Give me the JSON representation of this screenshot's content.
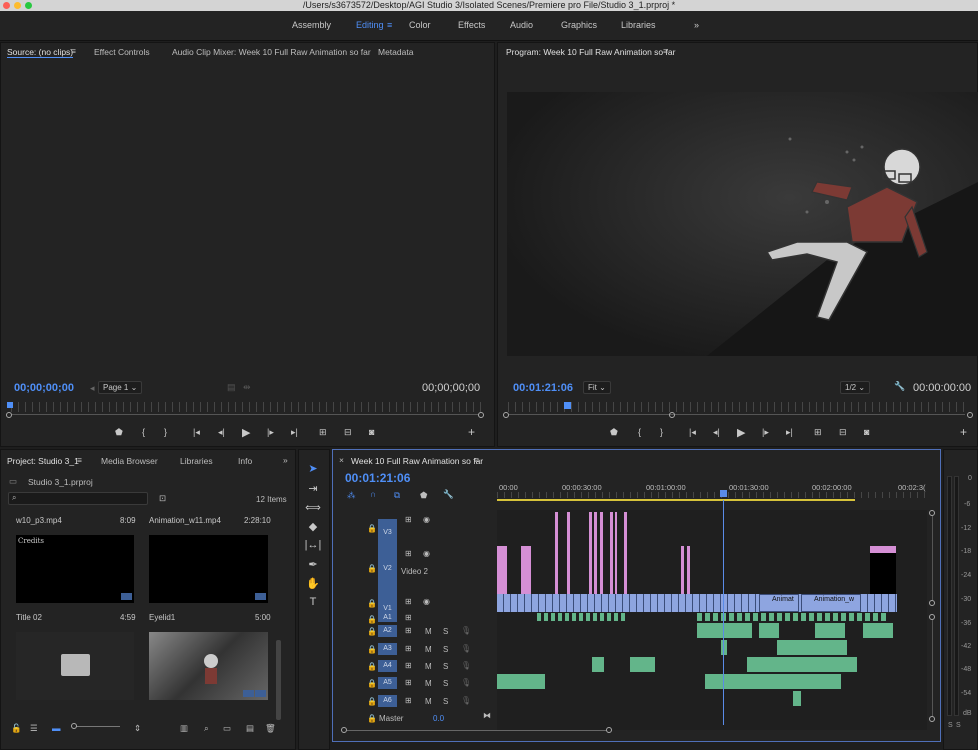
{
  "window": {
    "title": "/Users/s3673572/Desktop/AGI Studio 3/Isolated Scenes/Premiere pro File/Studio 3_1.prproj *"
  },
  "workspaces": {
    "items": [
      "Assembly",
      "Editing",
      "Color",
      "Effects",
      "Audio",
      "Graphics",
      "Libraries"
    ],
    "active": "Editing",
    "more": "»"
  },
  "source": {
    "tabs": [
      "Source: (no clips)",
      "Effect Controls",
      "Audio Clip Mixer: Week 10 Full Raw Animation so far",
      "Metadata"
    ],
    "timecode_in": "00;00;00;00",
    "timecode_out": "00;00;00;00",
    "page": "Page 1"
  },
  "program": {
    "title": "Program: Week 10 Full Raw Animation so far",
    "timecode": "00:01:21:06",
    "zoom": "Fit",
    "resolution": "1/2",
    "duration": "00:00:00:00"
  },
  "project": {
    "tabs": [
      "Project: Studio 3_1",
      "Media Browser",
      "Libraries",
      "Info"
    ],
    "more": "»",
    "file": "Studio 3_1.prproj",
    "count": "12 Items",
    "items": [
      {
        "name": "w10_p3.mp4",
        "dur": "8:09"
      },
      {
        "name": "Animation_w11.mp4",
        "dur": "2:28:10"
      },
      {
        "name": "Title 02",
        "dur": "4:59"
      },
      {
        "name": "Eyelid1",
        "dur": "5:00"
      }
    ],
    "thumb_text": "Credits"
  },
  "timeline": {
    "title": "Week 10 Full Raw Animation so far",
    "timecode": "00:01:21:06",
    "ruler": [
      "00:00",
      "00:00:30:00",
      "00:01:00:00",
      "00:01:30:00",
      "00:02:00:00",
      "00:02:3("
    ],
    "video_tracks": [
      {
        "id": "V3"
      },
      {
        "id": "V2",
        "name": "Video 2"
      },
      {
        "id": "V1"
      }
    ],
    "audio_tracks": [
      {
        "id": "A1"
      },
      {
        "id": "A2"
      },
      {
        "id": "A3"
      },
      {
        "id": "A4"
      },
      {
        "id": "A5"
      },
      {
        "id": "A6"
      }
    ],
    "master": {
      "label": "Master",
      "value": "0.0"
    },
    "clip_labels": [
      "Animat",
      "Animation_w"
    ],
    "mute": "M",
    "solo": "S"
  },
  "meters": {
    "ticks": [
      "0",
      "-6",
      "-12",
      "-18",
      "-24",
      "-30",
      "-36",
      "-42",
      "-48",
      "-54"
    ],
    "unit": "dB"
  },
  "colors": {
    "accent": "#4f8ff7",
    "video_clip": "#8ea5e0",
    "pink_clip": "#d58fd5",
    "audio_clip": "#63b58a",
    "track_label": "#3d5f96",
    "playhead": "#5a8be8"
  }
}
